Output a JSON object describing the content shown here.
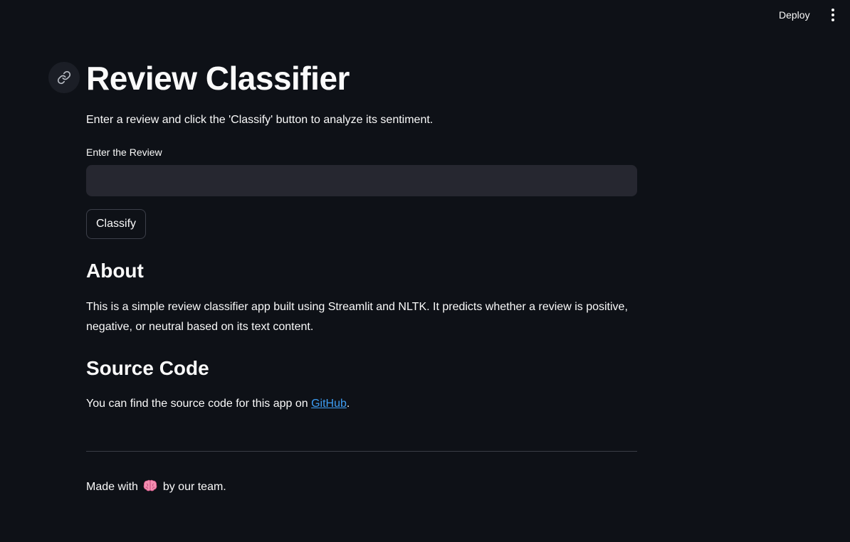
{
  "header": {
    "deploy_label": "Deploy",
    "menu_icon": "more-vertical-icon"
  },
  "main": {
    "anchor_icon": "link-icon",
    "title": "Review Classifier",
    "intro": "Enter a review and click the 'Classify' button to analyze its sentiment.",
    "review_field": {
      "label": "Enter the Review",
      "value": "",
      "placeholder": ""
    },
    "classify_label": "Classify",
    "about": {
      "heading": "About",
      "text": "This is a simple review classifier app built using Streamlit and NLTK. It predicts whether a review is positive, negative, or neutral based on its text content."
    },
    "source": {
      "heading": "Source Code",
      "text_before": "You can find the source code for this app on ",
      "link_label": "GitHub",
      "text_after": "."
    },
    "footer": {
      "text_before": "Made with ",
      "emoji_icon": "brain-icon",
      "text_after": " by our team."
    }
  },
  "colors": {
    "background": "#0e1117",
    "text": "#fafafa",
    "input_background": "#262730",
    "link": "#3d9df3",
    "accent_emoji": "#f48fb1"
  }
}
